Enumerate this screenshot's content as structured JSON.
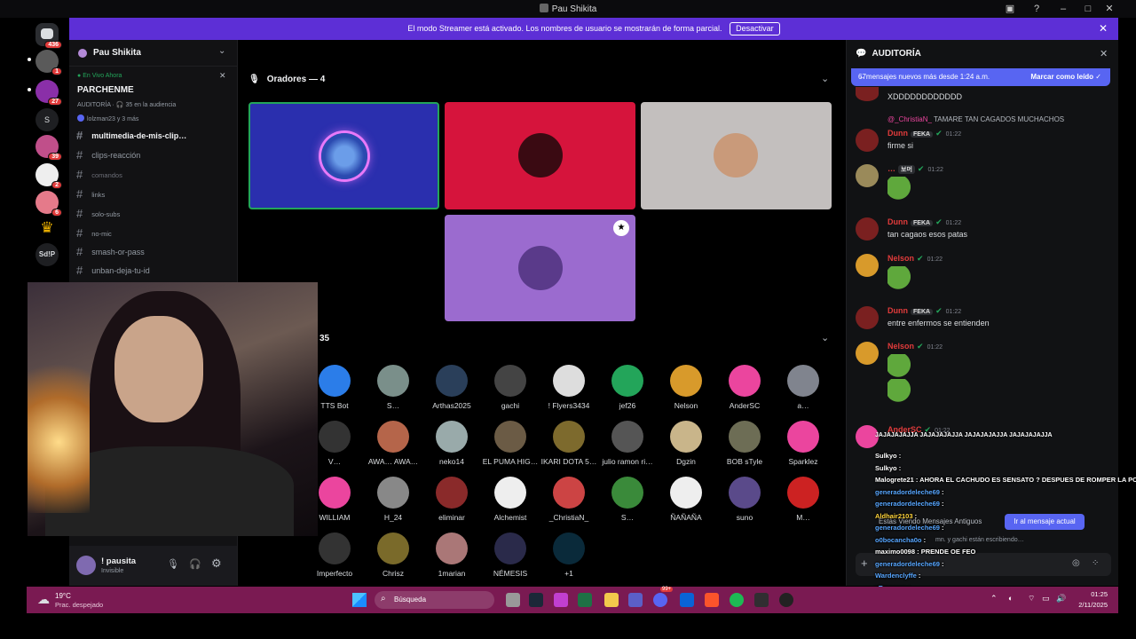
{
  "window": {
    "title": "Pau Shikita"
  },
  "banner": {
    "text": "El modo Streamer está activado. Los nombres de usuario se mostrarán de forma parcial.",
    "button": "Desactivar"
  },
  "rail": {
    "home_badge": "436",
    "servers": [
      {
        "badge": "1"
      },
      {
        "badge": "27"
      },
      {
        "label": "S"
      },
      {
        "badge": "39"
      },
      {
        "badge": "2"
      },
      {
        "badge": "6"
      },
      {
        "label": ""
      },
      {
        "label": "Sd!P"
      }
    ]
  },
  "channel_sidebar": {
    "server_name": "Pau Shikita",
    "live_label": "En Vivo Ahora",
    "stage_name": "PARCHENME",
    "audit_line": "AUDITORÍA · 🎧 35 en la audiencia",
    "members_line": "lolzman23 y 3 más",
    "channels": [
      {
        "name": "multimedia-de-mis-clip…"
      },
      {
        "name": "clips-reacción"
      },
      {
        "name": "comandos"
      },
      {
        "name": "links"
      },
      {
        "name": "solo-subs"
      },
      {
        "name": "no-mic"
      },
      {
        "name": "smash-or-pass"
      },
      {
        "name": "unban-deja-tu-id"
      }
    ],
    "user": {
      "name": "! pausita",
      "status": "Invisible"
    }
  },
  "stage": {
    "speakers_header": "Oradores — 4",
    "audience_count": "35",
    "audience": [
      {
        "name": "TTS Bot",
        "color": "#2b7de9"
      },
      {
        "name": "S…",
        "color": "#7a8f8a"
      },
      {
        "name": "Arthas2025",
        "color": "#2a3f5a"
      },
      {
        "name": "gachi",
        "color": "#444"
      },
      {
        "name": "! Flyers3434",
        "color": "#ddd"
      },
      {
        "name": "jef26",
        "color": "#23a55a"
      },
      {
        "name": "Nelson",
        "color": "#d89a2b"
      },
      {
        "name": "AnderSC",
        "color": "#eb459e"
      },
      {
        "name": "a…",
        "color": "#80848e"
      },
      {
        "name": "V…",
        "color": "#333"
      },
      {
        "name": "AWA… AWA…",
        "color": "#b5654a"
      },
      {
        "name": "neko14",
        "color": "#9aa"
      },
      {
        "name": "EL PUMA HIG…",
        "color": "#6b5b45"
      },
      {
        "name": "IKARI DOTA 5…",
        "color": "#7d6a2d"
      },
      {
        "name": "julio ramon ri…",
        "color": "#555"
      },
      {
        "name": "Dgzin",
        "color": "#c9b58a"
      },
      {
        "name": "BOB sTyle",
        "color": "#6d6d55"
      },
      {
        "name": "Sparklez",
        "color": "#eb459e"
      },
      {
        "name": "WILLIAM",
        "color": "#eb459e"
      },
      {
        "name": "H_24",
        "color": "#888"
      },
      {
        "name": "eliminar",
        "color": "#8a2a2a"
      },
      {
        "name": "Alchemist",
        "color": "#eee"
      },
      {
        "name": "_ChristiaN_",
        "color": "#c44"
      },
      {
        "name": "S…",
        "color": "#3a8a3a"
      },
      {
        "name": "ÑAÑAÑA",
        "color": "#eee"
      },
      {
        "name": "suno",
        "color": "#5a4a8a"
      },
      {
        "name": "M…",
        "color": "#c22"
      },
      {
        "name": "Imperfecto",
        "color": "#333"
      },
      {
        "name": "Chrisz",
        "color": "#7a6a2a"
      },
      {
        "name": "1marian",
        "color": "#a77"
      },
      {
        "name": "NÉMESIS",
        "color": "#2a2a4a"
      },
      {
        "name": "+1",
        "color": "#0a2a3a"
      }
    ]
  },
  "chat": {
    "title": "AUDITORÍA",
    "new_bar": "6̶7mensajes nuevos más desde 1:24 a.m.",
    "mark_read": "Marcar como leído",
    "first_text": "XDDDDDDDDDDDD",
    "reply_to": "@_ChristiaN_",
    "reply_text": "TAMARE TAN CAGADOS MUCHACHOS",
    "messages": [
      {
        "name": "Dunn",
        "tag": "FEKA",
        "time": "01:22",
        "text": "firme si",
        "color": "#e03b3b"
      },
      {
        "name": "…",
        "tag": "보머",
        "time": "01:22",
        "text": "",
        "color": "#e03b3b"
      },
      {
        "name": "Dunn",
        "tag": "FEKA",
        "time": "01:22",
        "text": "tan cagaos esos patas",
        "color": "#e03b3b"
      },
      {
        "name": "Nelson",
        "tag": "",
        "time": "01:22",
        "text": "",
        "color": "#e03b3b"
      },
      {
        "name": "Dunn",
        "tag": "FEKA",
        "time": "01:22",
        "text": "entre enfermos se entienden",
        "color": "#e03b3b"
      },
      {
        "name": "Nelson",
        "tag": "",
        "time": "01:22",
        "text": "",
        "color": "#e03b3b"
      },
      {
        "name": "AnderSC",
        "tag": "",
        "time": "01:22",
        "text": "",
        "color": "#e03b3b"
      }
    ],
    "old_messages": "Estás Viendo Mensajes Antiguos",
    "jump": "Ir al mensaje actual",
    "typing": "mn. y gachi están escribiendo…"
  },
  "overlay": [
    {
      "u": "Sulkyo",
      "t": ":"
    },
    {
      "u": "Sulkyo",
      "t": ":"
    },
    {
      "u": "Malogrete21",
      "t": ": AHORA EL CACHUDO ES SENSATO ? DESPUES DE ROMPER LA PC"
    },
    {
      "u": "generadordeleche69",
      "t": ":"
    },
    {
      "u": "generadordeleche69",
      "t": ":"
    },
    {
      "u": "Aldhair2103",
      "t": ":"
    },
    {
      "u": "generadordeleche69",
      "t": ":"
    },
    {
      "u": "o0bocancha0o",
      "t": ":"
    },
    {
      "u": "maximo0098",
      "t": ": PRENDE OE FEO"
    },
    {
      "u": "generadordeleche69",
      "t": ":"
    },
    {
      "u": "Wardenclyffe",
      "t": ":"
    },
    {
      "u": "zRevenge",
      "t": ":"
    },
    {
      "u": "Aldhair2103",
      "t": ":"
    }
  ],
  "overlay_top": "JAJAJAJAJJA    JAJAJAJAJJA    JAJAJAJAJJA    JAJAJAJAJJA",
  "taskbar": {
    "temp": "19°C",
    "weather": "Prac. despejado",
    "search": "Búsqueda",
    "time": "01:25",
    "date": "2/11/2025",
    "discord_badge": "99+"
  }
}
